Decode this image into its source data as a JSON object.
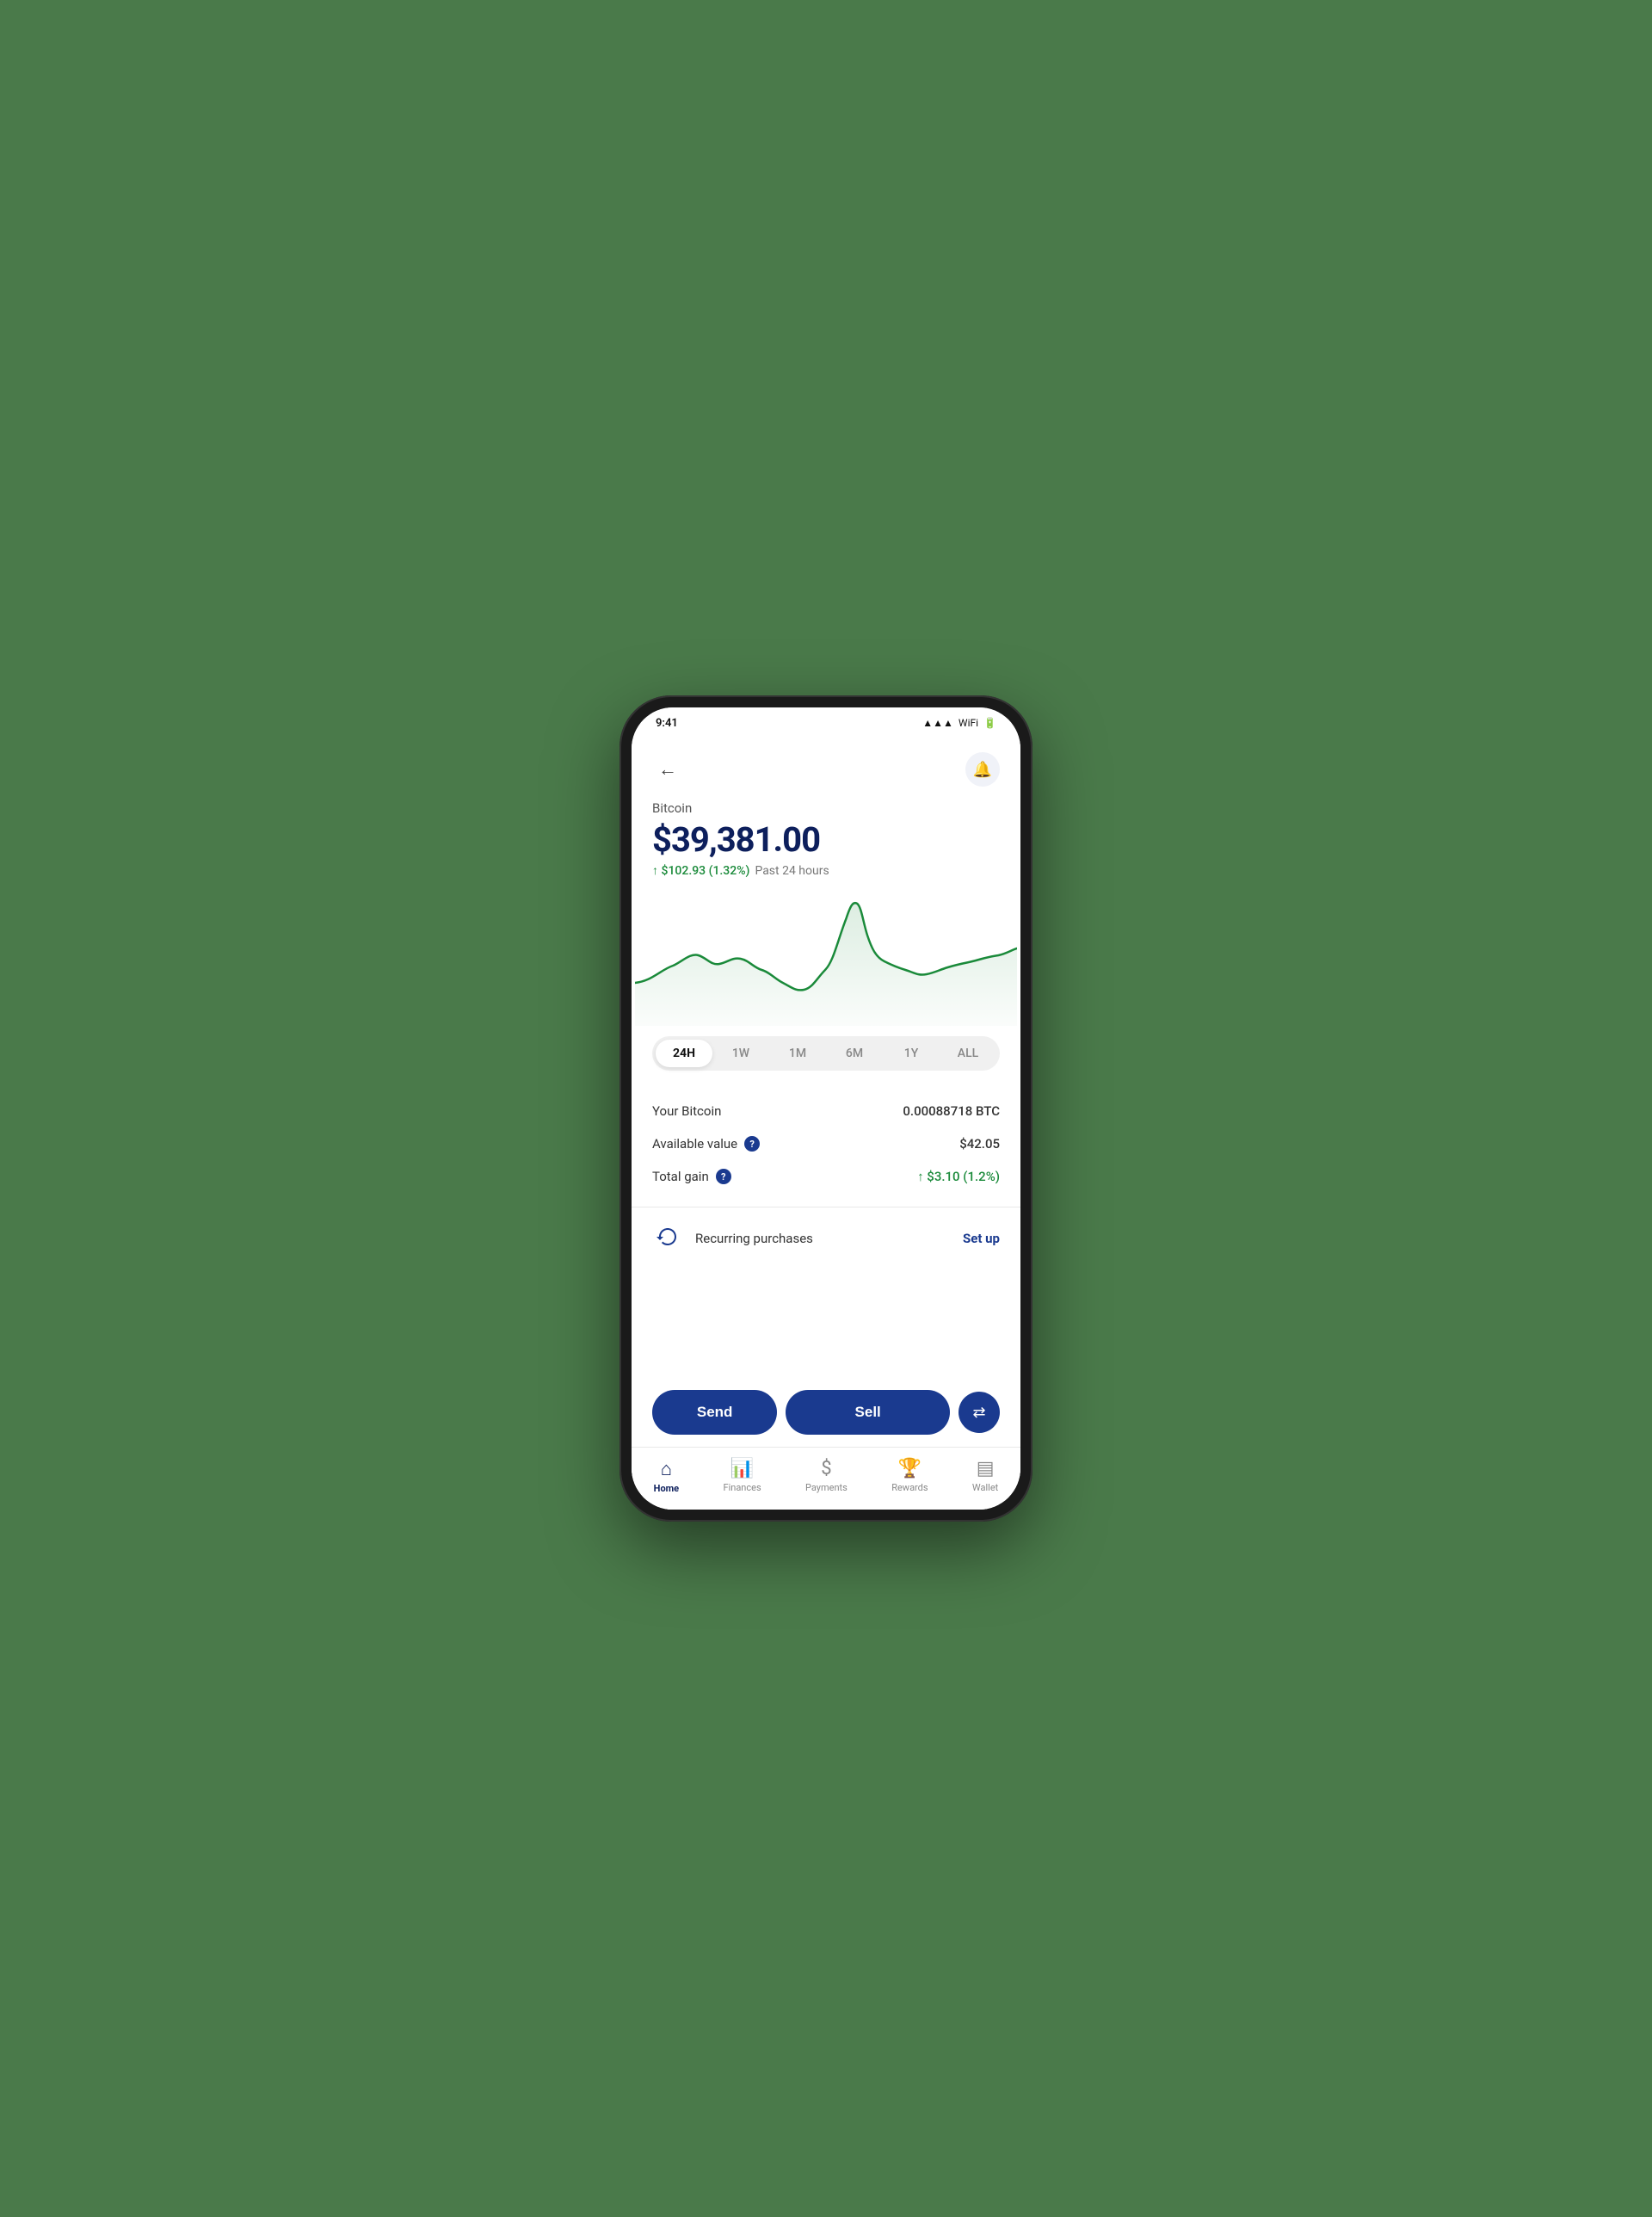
{
  "header": {
    "back_label": "←",
    "bell_label": "🔔"
  },
  "coin": {
    "name": "Bitcoin",
    "price": "$39,381.00",
    "change_amount": "$102.93",
    "change_percent": "1.32%",
    "change_period": "Past 24 hours"
  },
  "time_filters": [
    {
      "label": "24H",
      "active": true
    },
    {
      "label": "1W",
      "active": false
    },
    {
      "label": "1M",
      "active": false
    },
    {
      "label": "6M",
      "active": false
    },
    {
      "label": "1Y",
      "active": false
    },
    {
      "label": "ALL",
      "active": false
    }
  ],
  "stats": {
    "bitcoin_label": "Your Bitcoin",
    "bitcoin_value": "0.00088718 BTC",
    "available_label": "Available value",
    "available_info": "?",
    "available_value": "$42.05",
    "total_gain_label": "Total gain",
    "total_gain_info": "?",
    "total_gain_value": "↑ $3.10 (1.2%)"
  },
  "recurring": {
    "label": "Recurring purchases",
    "setup_label": "Set up"
  },
  "actions": {
    "send_label": "Send",
    "sell_label": "Sell",
    "swap_icon": "⇄"
  },
  "nav": [
    {
      "label": "Home",
      "active": true,
      "icon": "home"
    },
    {
      "label": "Finances",
      "active": false,
      "icon": "bar_chart"
    },
    {
      "label": "Payments",
      "active": false,
      "icon": "dollar"
    },
    {
      "label": "Rewards",
      "active": false,
      "icon": "trophy"
    },
    {
      "label": "Wallet",
      "active": false,
      "icon": "wallet"
    }
  ]
}
